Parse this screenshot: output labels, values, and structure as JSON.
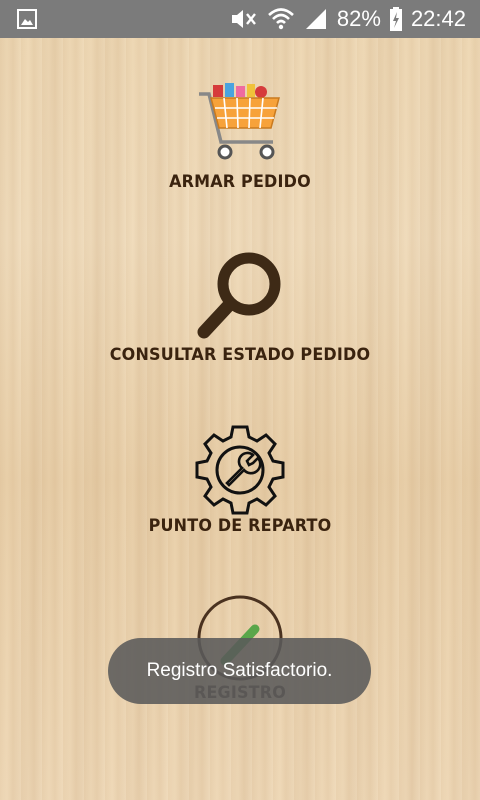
{
  "status_bar": {
    "battery": "82%",
    "time": "22:42",
    "icons": [
      "image-icon",
      "mute-icon",
      "wifi-icon",
      "signal-icon",
      "battery-charging-icon"
    ]
  },
  "menu": [
    {
      "label": "ARMAR PEDIDO",
      "icon": "shopping-cart-icon"
    },
    {
      "label": "CONSULTAR ESTADO PEDIDO",
      "icon": "magnifier-icon"
    },
    {
      "label": "PUNTO DE REPARTO",
      "icon": "gear-wrench-icon"
    },
    {
      "label": "REGISTRO",
      "icon": "pencil-icon"
    }
  ],
  "toast": {
    "message": "Registro Satisfactorio."
  },
  "colors": {
    "label": "#3a230f",
    "status_bar": "#7b7b7b",
    "toast": "#5a5a5a",
    "cart_accent": "#f7a23a"
  }
}
